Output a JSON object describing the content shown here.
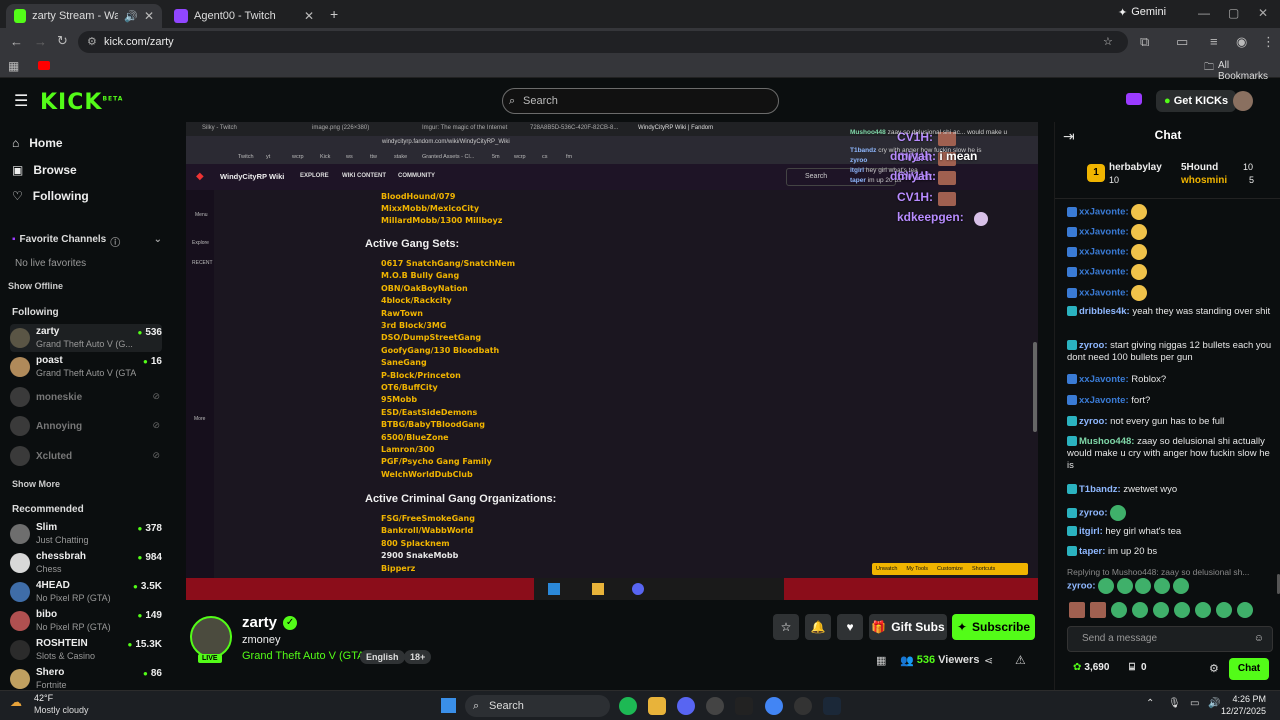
{
  "browser": {
    "tabs": [
      {
        "title": "zarty Stream - Watch Live o",
        "active": true
      },
      {
        "title": "Agent00 - Twitch",
        "active": false
      }
    ],
    "new_tab": "+",
    "gemini_label": "Gemini",
    "url": "kick.com/zarty",
    "all_bookmarks": "All Bookmarks"
  },
  "kick": {
    "logo": "KICK",
    "logo_sup": "BETA",
    "search_placeholder": "Search",
    "get_kicks": "Get KICKs"
  },
  "sidebar": {
    "nav": [
      "Home",
      "Browse",
      "Following"
    ],
    "favorite_channels": "Favorite Channels",
    "no_live_favorites": "No live favorites",
    "show_offline": "Show Offline",
    "following_header": "Following",
    "following": [
      {
        "name": "zarty",
        "category": "Grand Theft Auto V (G...",
        "viewers": "536",
        "live": true
      },
      {
        "name": "poast",
        "category": "Grand Theft Auto V (GTA)",
        "viewers": "16",
        "live": true
      },
      {
        "name": "moneskie",
        "live": false
      },
      {
        "name": "Annoying",
        "live": false
      },
      {
        "name": "Xcluted",
        "live": false
      }
    ],
    "show_more": "Show More",
    "recommended_header": "Recommended",
    "recommended": [
      {
        "name": "Slim",
        "category": "Just Chatting",
        "viewers": "378"
      },
      {
        "name": "chessbrah",
        "category": "Chess",
        "viewers": "984"
      },
      {
        "name": "4HEAD",
        "category": "No Pixel RP (GTA)",
        "viewers": "3.5K"
      },
      {
        "name": "bibo",
        "category": "No Pixel RP (GTA)",
        "viewers": "149"
      },
      {
        "name": "ROSHTEIN",
        "category": "Slots & Casino",
        "viewers": "15.3K"
      },
      {
        "name": "Shero",
        "category": "Fortnite",
        "viewers": "86"
      }
    ]
  },
  "video": {
    "inner_tabs": [
      "Silky - Twitch",
      "image.png (226×380)",
      "Imgur: The magic of the Internet",
      "728A8B5D-536C-420F-82CB-8...",
      "WindyCityRP Wiki | Fandom"
    ],
    "inner_url": "windycityrp.fandom.com/wiki/WindyCityRP_Wiki",
    "inner_bookmarks": [
      "Twitch",
      "yt",
      "wcrp",
      "Kick",
      "ws",
      "ttw",
      "stake",
      "Granted Assets - Cl...",
      "5m",
      "wcrp",
      "cs",
      "fm"
    ],
    "wiki_title": "WindyCityRP Wiki",
    "wiki_menu": [
      "EXPLORE",
      "WIKI CONTENT",
      "COMMUNITY"
    ],
    "wiki_search": "Search",
    "wiki_side": [
      "Menu",
      "Explore",
      "RECENT",
      "More"
    ],
    "top_list": [
      "BloodHound/079",
      "MixxMobb/MexicoCity",
      "MillardMobb/1300 Millboyz"
    ],
    "section1": "Active Gang Sets:",
    "gangs": [
      "0617 SnatchGang/SnatchNem",
      "M.O.B Bully Gang",
      "OBN/OakBoyNation",
      "4block/Rackcity",
      "RawTown",
      "3rd Block/3MG",
      "DSO/DumpStreetGang",
      "GoofyGang/130 Bloodbath",
      "SaneGang",
      "P-Block/Princeton",
      "OT6/BuffCity",
      "95Mobb",
      "ESD/EastSideDemons",
      "BTBG/BabyTBloodGang",
      "6500/BlueZone",
      "Lamron/300",
      "PGF/Psycho Gang Family",
      "WelchWorldDubClub"
    ],
    "section2": "Active Criminal Gang Organizations:",
    "orgs": [
      "FSG/FreeSmokeGang",
      "Bankroll/WabbWorld",
      "800 Splacknem",
      "2900 SnakeMobb",
      "Bipperz"
    ],
    "org_colors": [
      "#f0b400",
      "#f0b400",
      "#f0b400",
      "#e6e6e6",
      "#f0b400"
    ],
    "bottom_bar": [
      "Unwatch",
      "My Tools",
      "Customize",
      "Shortcuts"
    ],
    "overlay_chat": [
      {
        "user": "CV1H:",
        "text": ""
      },
      {
        "user": "CV1H:",
        "text": ""
      },
      {
        "user": "CV1H:",
        "text": ""
      },
      {
        "user": "CV1H:",
        "text": ""
      },
      {
        "user": "kdkeepgen:",
        "text": ""
      },
      {
        "user": "dmiyah:",
        "text": "i mean"
      },
      {
        "user": "dmiyah:",
        "text": ""
      }
    ],
    "inner_chat": [
      {
        "user": "Mushoo448",
        "text": "zaay so delusional shi ac... would make u"
      },
      {
        "user": "T1bandz",
        "text": "cry with anger how fuckin slow he is"
      },
      {
        "user": "zyroo",
        "text": ""
      },
      {
        "user": "itgirl",
        "text": "hey girl what's tea"
      },
      {
        "user": "taper",
        "text": "im up 20 bs"
      }
    ]
  },
  "stream": {
    "name": "zarty",
    "title": "zmoney",
    "category": "Grand Theft Auto V (GTA)",
    "tags": [
      "English",
      "18+"
    ],
    "live": "LIVE",
    "viewers": "536",
    "viewers_label": "Viewers",
    "gift_subs": "Gift Subs",
    "subscribe": "Subscribe"
  },
  "chat": {
    "title": "Chat",
    "leaderboard": [
      {
        "rank": "1",
        "name": "herbabylay",
        "count": "10"
      },
      {
        "name": "5Hound",
        "count": "10"
      },
      {
        "name": "whosmini",
        "count": "5"
      }
    ],
    "messages": [
      {
        "user": "xxJavonte:",
        "text": "",
        "emote": true,
        "color": "#3a7bd5"
      },
      {
        "user": "xxJavonte:",
        "text": "",
        "emote": true,
        "color": "#3a7bd5"
      },
      {
        "user": "xxJavonte:",
        "text": "",
        "emote": true,
        "color": "#3a7bd5"
      },
      {
        "user": "xxJavonte:",
        "text": "",
        "emote": true,
        "color": "#3a7bd5"
      },
      {
        "user": "xxJavonte:",
        "text": "",
        "emote": true,
        "color": "#3a7bd5"
      },
      {
        "user": "dribbles4k:",
        "text": "yeah they was standing over shit",
        "color": "#8fb8ff"
      },
      {
        "user": "zyroo:",
        "text": "start giving niggas 12 bullets each you dont need 100 bullets per gun",
        "color": "#8fb8ff"
      },
      {
        "user": "xxJavonte:",
        "text": "Roblox?",
        "color": "#3a7bd5"
      },
      {
        "user": "xxJavonte:",
        "text": "fort?",
        "color": "#3a7bd5"
      },
      {
        "user": "zyroo:",
        "text": "not every gun has to be full",
        "color": "#8fb8ff"
      },
      {
        "user": "Mushoo448:",
        "text": "zaay so delusional shi actually would make u cry with anger how fuckin slow he is",
        "color": "#7fd7a8"
      },
      {
        "user": "T1bandz:",
        "text": "zwetwet wyo",
        "color": "#8fb8ff"
      },
      {
        "user": "zyroo:",
        "text": "",
        "emote": true,
        "color": "#8fb8ff"
      },
      {
        "user": "itgirl:",
        "text": "hey girl what's tea",
        "color": "#8fb8ff"
      },
      {
        "user": "taper:",
        "text": "im up 20 bs",
        "color": "#8fb8ff"
      }
    ],
    "reply_to": "Replying to Mushoo448: zaay so delusional sh...",
    "reply_user": "zyroo:",
    "send_placeholder": "Send a message",
    "points": "3,690",
    "gifts": "0",
    "chat_button": "Chat"
  },
  "taskbar": {
    "weather_temp": "42°F",
    "weather_desc": "Mostly cloudy",
    "search": "Search",
    "time": "4:26 PM",
    "date": "12/27/2025"
  },
  "colors": {
    "kick_green": "#53fc18",
    "bg": "#0b0e0f",
    "wiki_gold": "#f0b400"
  }
}
